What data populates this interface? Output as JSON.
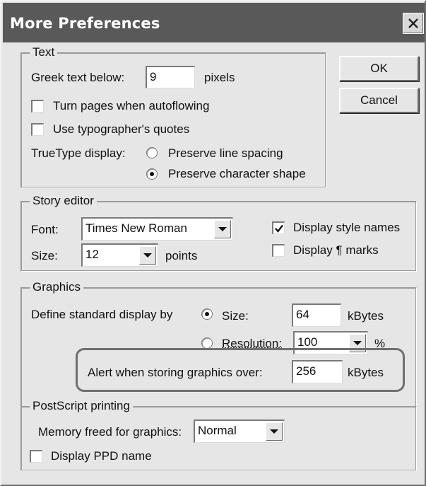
{
  "window": {
    "title": "More Preferences",
    "close_icon": "close-icon"
  },
  "buttons": {
    "ok": "OK",
    "cancel": "Cancel"
  },
  "text_group": {
    "title": "Text",
    "greek_label": "Greek text below:",
    "greek_value": "9",
    "greek_unit": "pixels",
    "turn_pages_label": "Turn pages when autoflowing",
    "turn_pages_checked": false,
    "typographers_label": "Use typographer's quotes",
    "typographers_checked": false,
    "truetype_label": "TrueType display:",
    "preserve_spacing_label": "Preserve line spacing",
    "preserve_spacing_selected": false,
    "preserve_shape_label": "Preserve character shape",
    "preserve_shape_selected": true
  },
  "story_editor": {
    "title": "Story editor",
    "font_label": "Font:",
    "font_value": "Times New Roman",
    "size_label": "Size:",
    "size_value": "12",
    "size_unit": "points",
    "display_style_label": "Display style names",
    "display_style_checked": true,
    "display_marks_label": "Display ¶ marks",
    "display_marks_checked": false
  },
  "graphics": {
    "title": "Graphics",
    "define_label": "Define standard display by",
    "size_radio_label": "Size:",
    "size_radio_selected": true,
    "size_value": "64",
    "size_unit": "kBytes",
    "resolution_radio_label": "Resolution:",
    "resolution_radio_selected": false,
    "resolution_value": "100",
    "resolution_unit": "%",
    "alert_label": "Alert when storing graphics over:",
    "alert_value": "256",
    "alert_unit": "kBytes"
  },
  "postscript": {
    "title": "PostScript printing",
    "memory_label": "Memory freed for graphics:",
    "memory_value": "Normal",
    "ppd_label": "Display PPD name",
    "ppd_checked": false
  },
  "colors": {
    "titlebar": "#595959",
    "dialog_bg": "#e6e6e6",
    "highlight_ring": "#6f6f6f"
  }
}
